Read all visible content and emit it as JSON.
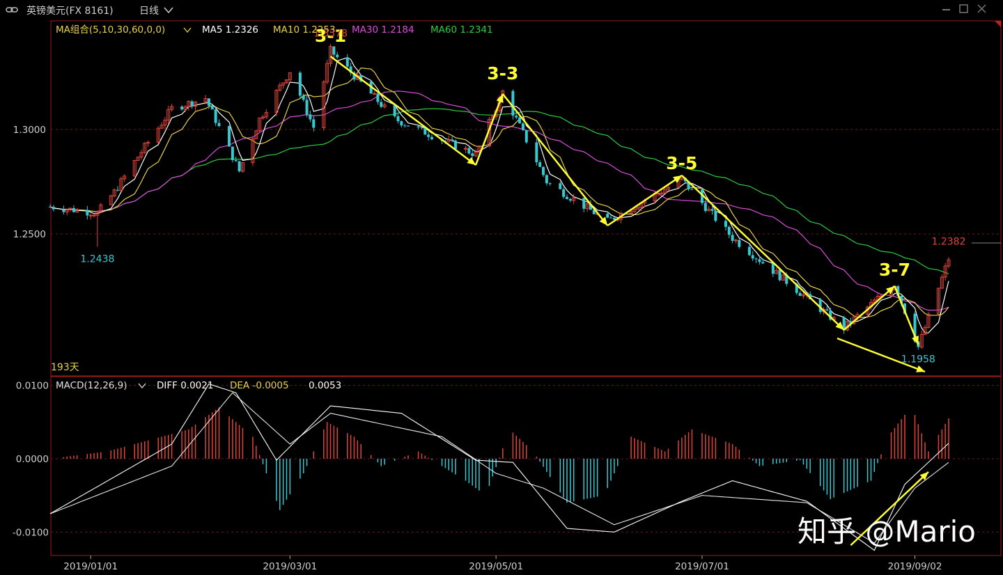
{
  "header": {
    "link_icon": "link-icon",
    "instrument": "英镑美元(FX 8161)",
    "period": "日线",
    "period_icon": "chevron-down-icon"
  },
  "ma_legend": {
    "combo": "MA组合(5,10,30,60,0,0)",
    "combo_icon": "chevron-down-icon",
    "items": [
      {
        "label": "MA5 1.2326",
        "color": "#ffffff"
      },
      {
        "label": "MA10 1.2253",
        "color": "#e8d24a"
      },
      {
        "label": "MA30 1.2184",
        "color": "#d94fd9"
      },
      {
        "label": "MA60 1.2341",
        "color": "#2ecc40"
      }
    ]
  },
  "macd_legend": {
    "combo": "MACD(12,26,9)",
    "combo_icon": "chevron-down-icon",
    "diff": "DIFF 0.0021",
    "dea": "DEA -0.0005",
    "macd": "0.0053"
  },
  "days_label": "193天",
  "annotations": {
    "high_label": "1.3378",
    "low_label_left": "1.2438",
    "high_label_right": "1.2382",
    "low_label_right": "1.1958",
    "waves": [
      "3-1",
      "3-3",
      "3-5",
      "3-7"
    ]
  },
  "watermark": "知乎 @Mario",
  "colors": {
    "up": "#e0453c",
    "down": "#38c8d2",
    "ma5": "#ffffff",
    "ma10": "#e8d24a",
    "ma30": "#d94fd9",
    "ma60": "#2ecc40",
    "wave": "#ffff33",
    "frame": "#9c1c1c",
    "grid": "#6a1a1a"
  },
  "chart_data": [
    {
      "type": "candlestick",
      "y_ticks": [
        "1.3000",
        "1.2500"
      ],
      "x_ticks": [
        "2019/01/01",
        "2019/03/01",
        "2019/05/01",
        "2019/07/01",
        "2019/09/02"
      ],
      "ylim": [
        1.182,
        1.352
      ],
      "date_range": [
        "2018/12/20",
        "2019/09/12"
      ],
      "price_path": [
        {
          "date": "2018/12/20",
          "price": 1.263
        },
        {
          "date": "2019/01/03",
          "price": 1.26
        },
        {
          "date": "2019/01/08",
          "price": 1.27
        },
        {
          "date": "2019/01/15",
          "price": 1.287
        },
        {
          "date": "2019/01/25",
          "price": 1.31
        },
        {
          "date": "2019/02/04",
          "price": 1.315
        },
        {
          "date": "2019/02/14",
          "price": 1.28
        },
        {
          "date": "2019/02/20",
          "price": 1.305
        },
        {
          "date": "2019/03/01",
          "price": 1.328
        },
        {
          "date": "2019/03/08",
          "price": 1.301
        },
        {
          "date": "2019/03/13",
          "price": 1.3378
        },
        {
          "date": "2019/04/01",
          "price": 1.305
        },
        {
          "date": "2019/04/25",
          "price": 1.288
        },
        {
          "date": "2019/05/03",
          "price": 1.318
        },
        {
          "date": "2019/05/16",
          "price": 1.275
        },
        {
          "date": "2019/06/03",
          "price": 1.256
        },
        {
          "date": "2019/06/25",
          "price": 1.276
        },
        {
          "date": "2019/07/10",
          "price": 1.248
        },
        {
          "date": "2019/08/12",
          "price": 1.205
        },
        {
          "date": "2019/08/27",
          "price": 1.226
        },
        {
          "date": "2019/09/03",
          "price": 1.1958
        },
        {
          "date": "2019/09/12",
          "price": 1.2382
        }
      ],
      "ma_latest": {
        "MA5": 1.2326,
        "MA10": 1.2253,
        "MA30": 1.2184,
        "MA60": 1.2341
      },
      "marked_extremes": [
        {
          "date": "2019/01/03",
          "price": 1.2438,
          "label": "1.2438"
        },
        {
          "date": "2019/03/13",
          "price": 1.3378,
          "label": "1.3378"
        },
        {
          "date": "2019/09/03",
          "price": 1.1958,
          "label": "1.1958"
        },
        {
          "date": "2019/09/12",
          "price": 1.2382,
          "label": "1.2382"
        }
      ],
      "wave_labels": [
        {
          "label": "3-1",
          "date": "2019/03/13",
          "price": 1.342
        },
        {
          "label": "3-3",
          "date": "2019/05/03",
          "price": 1.324
        },
        {
          "label": "3-5",
          "date": "2019/06/25",
          "price": 1.281
        },
        {
          "label": "3-7",
          "date": "2019/08/27",
          "price": 1.23
        }
      ],
      "wave_arrows": [
        {
          "from": {
            "date": "2019/03/13",
            "price": 1.335
          },
          "to": {
            "date": "2019/04/25",
            "price": 1.283
          }
        },
        {
          "from": {
            "date": "2019/04/25",
            "price": 1.283
          },
          "to": {
            "date": "2019/05/03",
            "price": 1.317
          }
        },
        {
          "from": {
            "date": "2019/05/03",
            "price": 1.317
          },
          "to": {
            "date": "2019/06/03",
            "price": 1.254
          }
        },
        {
          "from": {
            "date": "2019/06/03",
            "price": 1.254
          },
          "to": {
            "date": "2019/06/25",
            "price": 1.278
          }
        },
        {
          "from": {
            "date": "2019/06/25",
            "price": 1.278
          },
          "to": {
            "date": "2019/08/12",
            "price": 1.204
          }
        },
        {
          "from": {
            "date": "2019/08/12",
            "price": 1.204
          },
          "to": {
            "date": "2019/08/27",
            "price": 1.225
          }
        },
        {
          "from": {
            "date": "2019/08/27",
            "price": 1.225
          },
          "to": {
            "date": "2019/09/03",
            "price": 1.197
          }
        },
        {
          "from": {
            "date": "2019/08/10",
            "price": 1.2
          },
          "to": {
            "date": "2019/09/05",
            "price": 1.184
          }
        }
      ]
    },
    {
      "type": "macd",
      "y_ticks": [
        "0.0100",
        "0.0000",
        "-0.0100"
      ],
      "ylim": [
        -0.0132,
        0.0112
      ],
      "diff_path": [
        {
          "date": "2018/12/20",
          "value": -0.0075
        },
        {
          "date": "2019/01/25",
          "value": 0.002
        },
        {
          "date": "2019/02/05",
          "value": 0.0102
        },
        {
          "date": "2019/02/13",
          "value": 0.009
        },
        {
          "date": "2019/02/25",
          "value": -0.0002
        },
        {
          "date": "2019/03/13",
          "value": 0.0072
        },
        {
          "date": "2019/04/03",
          "value": 0.0062
        },
        {
          "date": "2019/04/25",
          "value": -0.0002
        },
        {
          "date": "2019/05/06",
          "value": -0.0005
        },
        {
          "date": "2019/05/22",
          "value": -0.0095
        },
        {
          "date": "2019/06/05",
          "value": -0.01
        },
        {
          "date": "2019/06/25",
          "value": -0.0058
        },
        {
          "date": "2019/07/10",
          "value": -0.003
        },
        {
          "date": "2019/08/01",
          "value": -0.0058
        },
        {
          "date": "2019/08/21",
          "value": -0.0125
        },
        {
          "date": "2019/08/30",
          "value": -0.0035
        },
        {
          "date": "2019/09/12",
          "value": 0.0021
        }
      ],
      "dea_path": [
        {
          "date": "2018/12/20",
          "value": -0.0075
        },
        {
          "date": "2019/01/25",
          "value": -0.001
        },
        {
          "date": "2019/02/12",
          "value": 0.009
        },
        {
          "date": "2019/03/01",
          "value": 0.002
        },
        {
          "date": "2019/03/13",
          "value": 0.0062
        },
        {
          "date": "2019/04/15",
          "value": 0.003
        },
        {
          "date": "2019/05/01",
          "value": -0.002
        },
        {
          "date": "2019/05/15",
          "value": -0.004
        },
        {
          "date": "2019/06/05",
          "value": -0.009
        },
        {
          "date": "2019/07/01",
          "value": -0.005
        },
        {
          "date": "2019/08/01",
          "value": -0.006
        },
        {
          "date": "2019/08/21",
          "value": -0.0115
        },
        {
          "date": "2019/09/02",
          "value": -0.004
        },
        {
          "date": "2019/09/12",
          "value": -0.0005
        }
      ],
      "histogram_path": [
        {
          "date": "2018/12/20",
          "value": 0.0
        },
        {
          "date": "2019/01/06",
          "value": 0.001
        },
        {
          "date": "2019/01/30",
          "value": 0.004
        },
        {
          "date": "2019/02/08",
          "value": 0.007
        },
        {
          "date": "2019/02/18",
          "value": 0.003
        },
        {
          "date": "2019/02/26",
          "value": -0.007
        },
        {
          "date": "2019/03/05",
          "value": -0.002
        },
        {
          "date": "2019/03/12",
          "value": 0.005
        },
        {
          "date": "2019/03/20",
          "value": 0.003
        },
        {
          "date": "2019/03/28",
          "value": -0.001
        },
        {
          "date": "2019/04/08",
          "value": 0.001
        },
        {
          "date": "2019/04/22",
          "value": -0.003
        },
        {
          "date": "2019/04/28",
          "value": -0.005
        },
        {
          "date": "2019/05/05",
          "value": 0.004
        },
        {
          "date": "2019/05/12",
          "value": 0.001
        },
        {
          "date": "2019/05/22",
          "value": -0.006
        },
        {
          "date": "2019/06/02",
          "value": -0.005
        },
        {
          "date": "2019/06/10",
          "value": 0.003
        },
        {
          "date": "2019/06/20",
          "value": 0.001
        },
        {
          "date": "2019/06/28",
          "value": 0.004
        },
        {
          "date": "2019/07/10",
          "value": 0.002
        },
        {
          "date": "2019/07/18",
          "value": -0.001
        },
        {
          "date": "2019/07/30",
          "value": -0.0002
        },
        {
          "date": "2019/08/08",
          "value": -0.0055
        },
        {
          "date": "2019/08/20",
          "value": -0.003
        },
        {
          "date": "2019/08/25",
          "value": 0.003
        },
        {
          "date": "2019/09/01",
          "value": 0.0072
        },
        {
          "date": "2019/09/06",
          "value": 0.001
        },
        {
          "date": "2019/09/12",
          "value": 0.0055
        }
      ],
      "arrow": {
        "from": {
          "date": "2019/08/14",
          "value": -0.0118
        },
        "to": {
          "date": "2019/09/06",
          "value": -0.0018
        }
      }
    }
  ]
}
